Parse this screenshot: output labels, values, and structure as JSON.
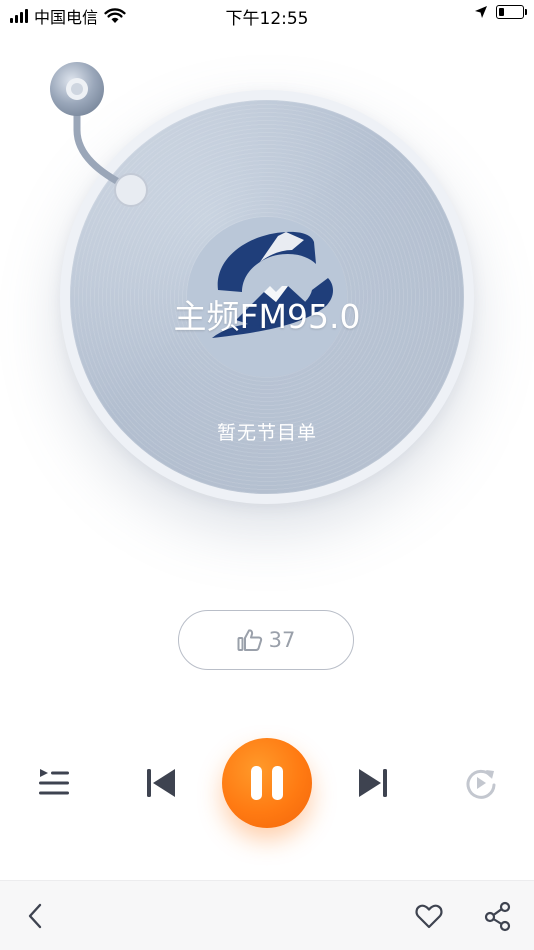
{
  "status_bar": {
    "carrier": "中国电信",
    "time": "下午12:55",
    "battery_level": 0.2,
    "icons": [
      "signal-bars",
      "wifi-icon",
      "location-arrow-icon",
      "battery-icon"
    ]
  },
  "player": {
    "station_title": "主频FM95.0",
    "program_text": "暂无节目单",
    "logo": "station-logo",
    "state": "playing"
  },
  "like": {
    "icon": "thumbs-up-icon",
    "count": "37"
  },
  "controls": {
    "icons": [
      "playlist-icon",
      "previous-icon",
      "pause-icon",
      "next-icon",
      "replay-icon"
    ],
    "accent_color": "#ff7a12"
  },
  "bottom_bar": {
    "icons": [
      "back-icon",
      "heart-icon",
      "share-icon"
    ]
  }
}
